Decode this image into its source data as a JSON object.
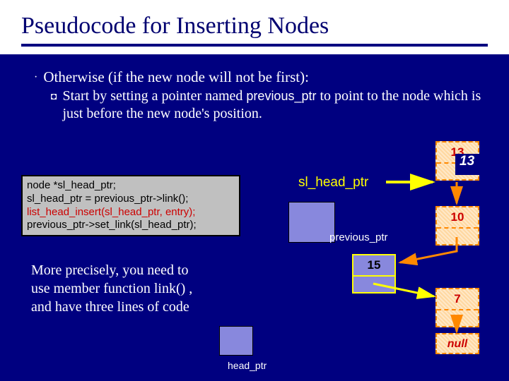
{
  "title": "Pseudocode for Inserting Nodes",
  "bullet": {
    "marker": "·",
    "text": "Otherwise (if the new node will not be first):"
  },
  "subbullet": {
    "marker": "◘",
    "line_pre": "Start by setting a pointer named ",
    "ident": "previous_ptr",
    "line_post": " to point to the node which is just before the new node's position."
  },
  "code": {
    "l1": "node *sl_head_ptr;",
    "l2": "sl_head_ptr = previous_ptr->link();",
    "l3": "list_head_insert(sl_head_ptr, entry);",
    "l4": "previous_ptr->set_link(sl_head_ptr);"
  },
  "note": "More precisely, you need to use member function link() , and have three lines of code",
  "labels": {
    "head_ptr": "head_ptr",
    "sl_head_ptr": "sl_head_ptr",
    "previous_ptr": "previous_ptr"
  },
  "nodes": {
    "n13": "13",
    "n10": "10",
    "n15": "15",
    "n7": "7",
    "nnull": "null"
  },
  "inline13": "13"
}
